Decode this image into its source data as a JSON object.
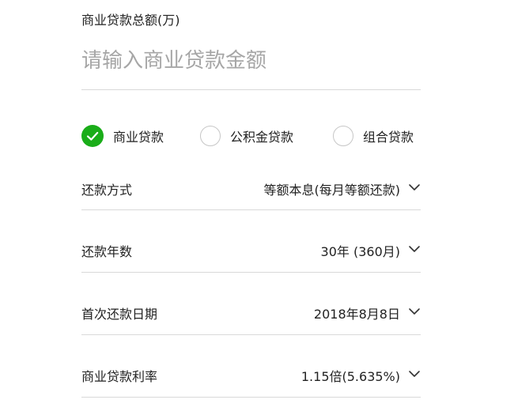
{
  "amount": {
    "label": "商业贷款总额(万)",
    "placeholder": "请输入商业贷款金额",
    "value": ""
  },
  "loan_types": [
    {
      "label": "商业贷款",
      "selected": true
    },
    {
      "label": "公积金贷款",
      "selected": false
    },
    {
      "label": "组合贷款",
      "selected": false
    }
  ],
  "settings": {
    "repayment_method": {
      "label": "还款方式",
      "value": "等额本息(每月等额还款)"
    },
    "repayment_years": {
      "label": "还款年数",
      "value": "30年 (360月)"
    },
    "first_payment_date": {
      "label": "首次还款日期",
      "value": "2018年8月8日"
    },
    "interest_rate": {
      "label": "商业贷款利率",
      "value": "1.15倍(5.635%)"
    }
  },
  "colors": {
    "accent": "#1AAD19",
    "divider": "#d9d9d9",
    "placeholder": "#a6a6a6",
    "radio_border": "#c7c7c7"
  },
  "icons": {
    "selected_radio": "check-circle-icon",
    "dropdown": "chevron-down-icon"
  }
}
